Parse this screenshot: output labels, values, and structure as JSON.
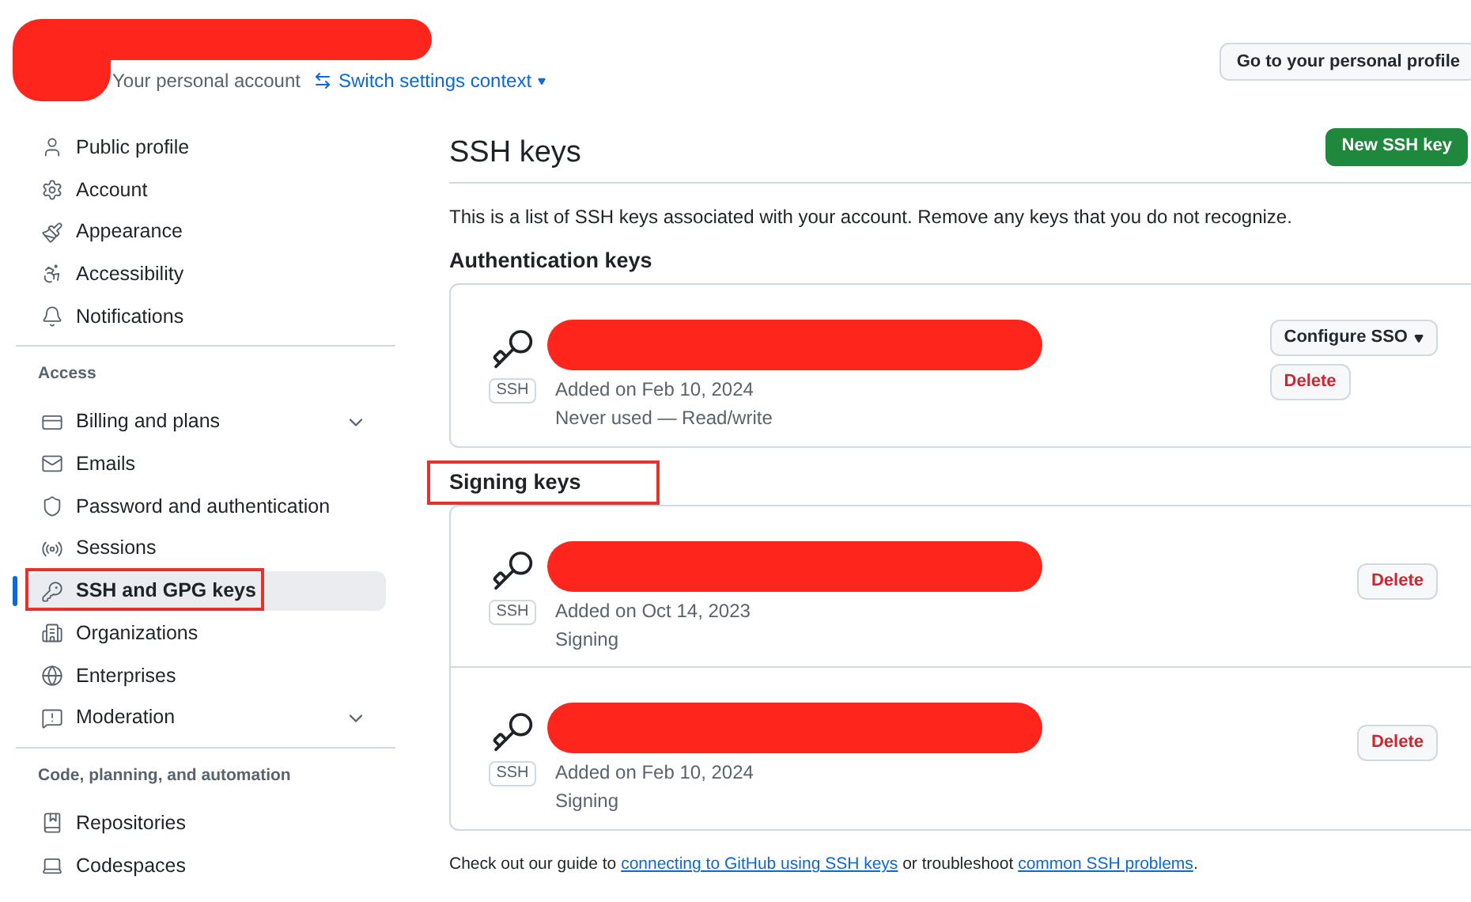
{
  "header": {
    "redacted": true,
    "account_label": "Your personal account",
    "switch_link": "Switch settings context",
    "profile_button": "Go to your personal profile"
  },
  "sidebar": {
    "groups": [
      {
        "items": [
          {
            "label": "Public profile",
            "selected": false,
            "annotated": false
          },
          {
            "label": "Account",
            "selected": false,
            "annotated": false
          },
          {
            "label": "Appearance",
            "selected": false,
            "annotated": false
          },
          {
            "label": "Accessibility",
            "selected": false,
            "annotated": false
          },
          {
            "label": "Notifications",
            "selected": false,
            "annotated": false
          }
        ]
      },
      {
        "title": "Access",
        "items": [
          {
            "label": "Billing and plans",
            "selected": false,
            "annotated": false,
            "expanded": false
          },
          {
            "label": "Emails",
            "selected": false,
            "annotated": false
          },
          {
            "label": "Password and authentication",
            "selected": false,
            "annotated": false
          },
          {
            "label": "Sessions",
            "selected": false,
            "annotated": false
          },
          {
            "label": "SSH and GPG keys",
            "selected": true,
            "annotated": true
          },
          {
            "label": "Organizations",
            "selected": false,
            "annotated": false
          },
          {
            "label": "Enterprises",
            "selected": false,
            "annotated": false
          },
          {
            "label": "Moderation",
            "selected": false,
            "annotated": false,
            "expanded": false
          }
        ]
      },
      {
        "title": "Code, planning, and automation",
        "items": [
          {
            "label": "Repositories",
            "selected": false,
            "annotated": false
          },
          {
            "label": "Codespaces",
            "selected": false,
            "annotated": false
          }
        ]
      }
    ]
  },
  "main": {
    "title": "SSH keys",
    "new_button": "New SSH key",
    "intro": "This is a list of SSH keys associated with your account. Remove any keys that you do not recognize.",
    "sections": [
      {
        "heading": "Authentication keys",
        "annotated": false,
        "keys": [
          {
            "badge": "SSH",
            "redacted": true,
            "added": "Added on Feb 10, 2024",
            "usage": "Never used — Read/write",
            "sso_button": "Configure SSO",
            "delete_button": "Delete"
          }
        ]
      },
      {
        "heading": "Signing keys",
        "annotated": true,
        "keys": [
          {
            "badge": "SSH",
            "redacted": true,
            "added": "Added on Oct 14, 2023",
            "usage": "Signing",
            "delete_button": "Delete"
          },
          {
            "badge": "SSH",
            "redacted": true,
            "added": "Added on Feb 10, 2024",
            "usage": "Signing",
            "delete_button": "Delete"
          }
        ]
      }
    ],
    "footer": {
      "before": "Check out our guide to",
      "link1": "connecting to GitHub using SSH keys",
      "middle": "or troubleshoot",
      "link2": "common SSH problems",
      "after": "."
    }
  }
}
